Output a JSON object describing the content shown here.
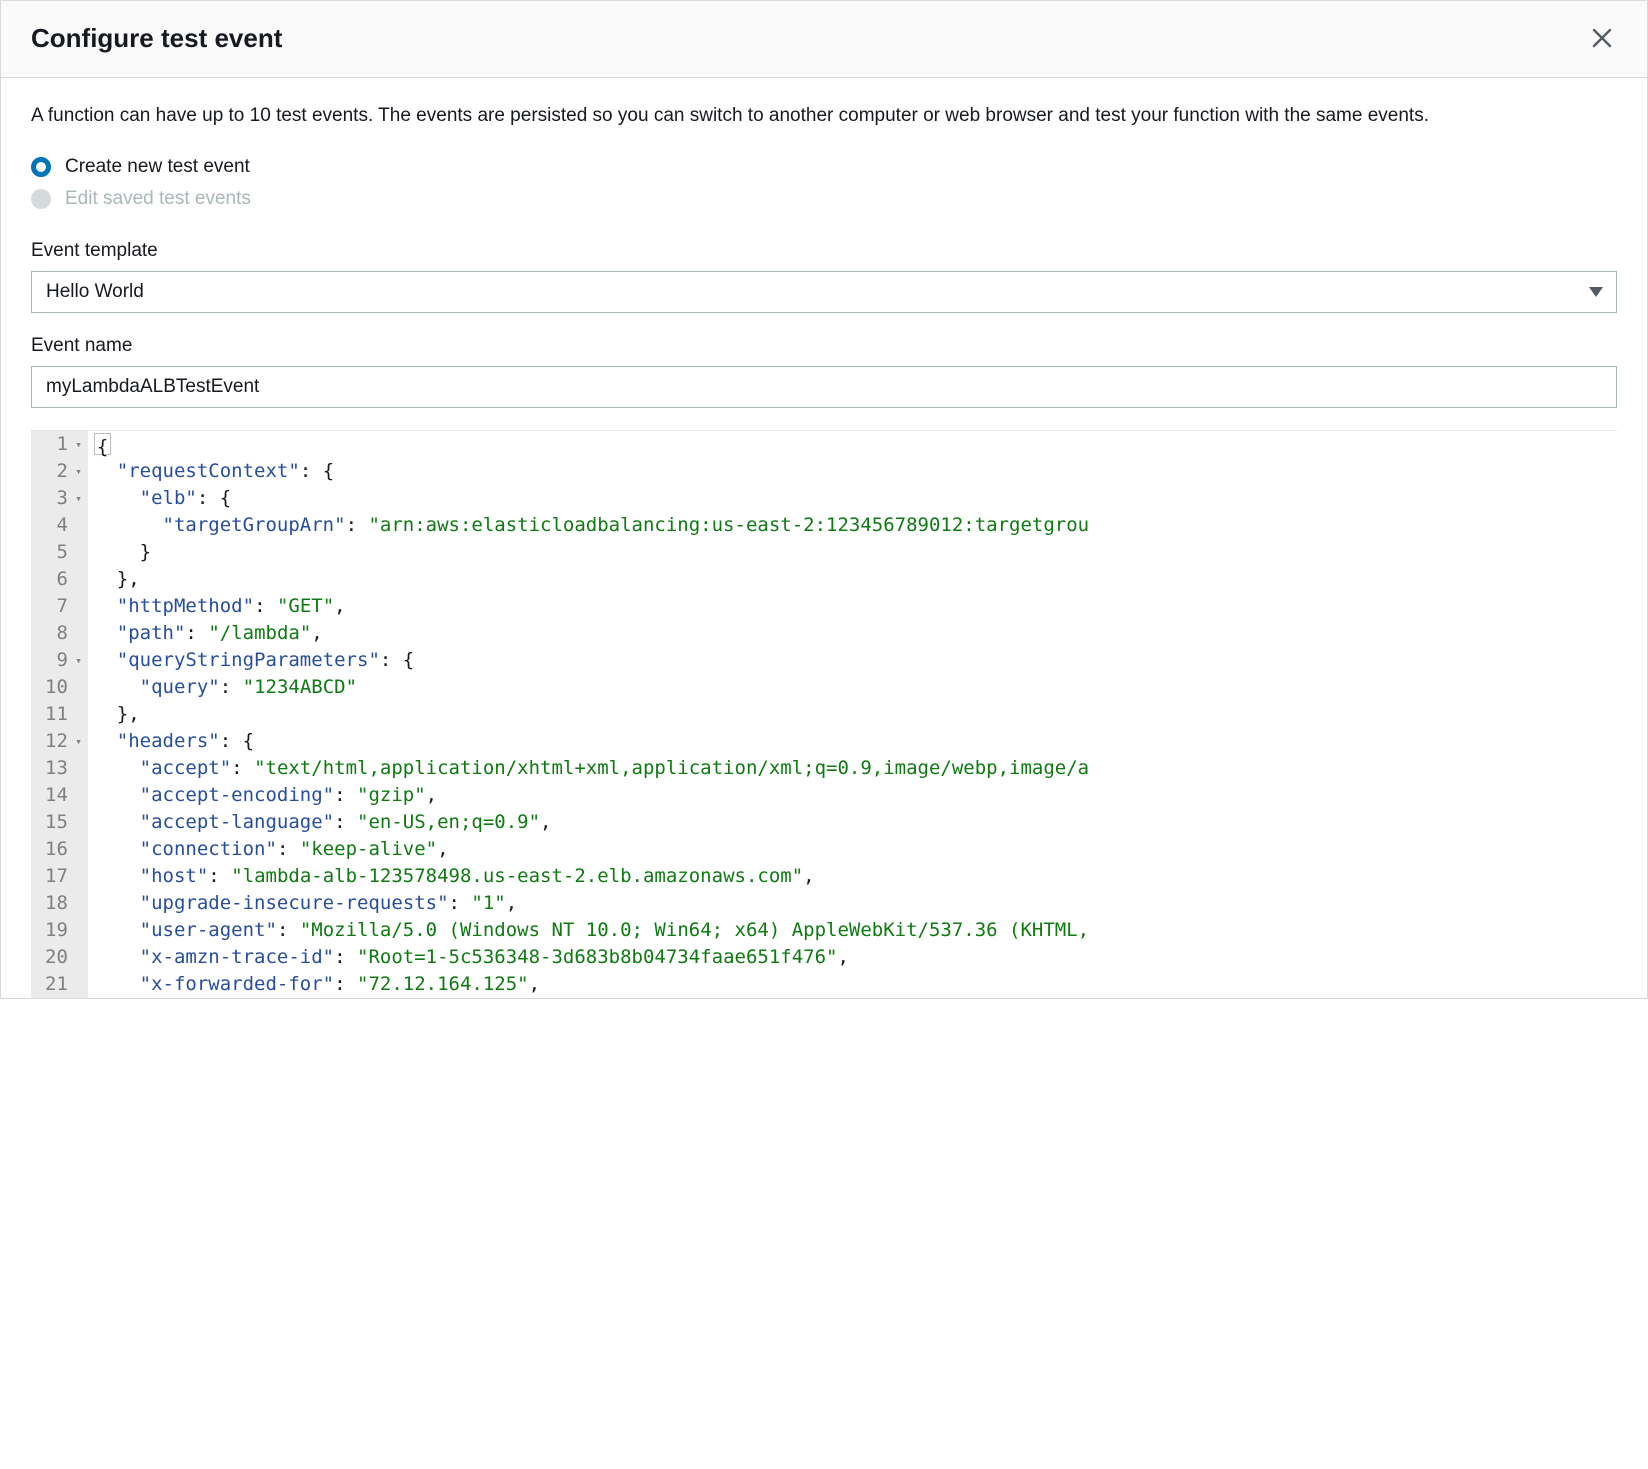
{
  "modal": {
    "title": "Configure test event",
    "description": "A function can have up to 10 test events. The events are persisted so you can switch to another computer or web browser and test your function with the same events."
  },
  "radios": {
    "create": "Create new test event",
    "edit": "Edit saved test events"
  },
  "template": {
    "label": "Event template",
    "value": "Hello World"
  },
  "eventName": {
    "label": "Event name",
    "value": "myLambdaALBTestEvent"
  },
  "code": {
    "lines": [
      {
        "n": 1,
        "fold": true,
        "indent": 0,
        "segs": [
          {
            "t": "{",
            "c": "brace"
          }
        ],
        "active": true
      },
      {
        "n": 2,
        "fold": true,
        "indent": 1,
        "segs": [
          {
            "t": "\"requestContext\"",
            "c": "key"
          },
          {
            "t": ": ",
            "c": "punc"
          },
          {
            "t": "{",
            "c": "brace"
          }
        ]
      },
      {
        "n": 3,
        "fold": true,
        "indent": 2,
        "segs": [
          {
            "t": "\"elb\"",
            "c": "key"
          },
          {
            "t": ": ",
            "c": "punc"
          },
          {
            "t": "{",
            "c": "brace"
          }
        ]
      },
      {
        "n": 4,
        "fold": false,
        "indent": 3,
        "segs": [
          {
            "t": "\"targetGroupArn\"",
            "c": "key"
          },
          {
            "t": ": ",
            "c": "punc"
          },
          {
            "t": "\"arn:aws:elasticloadbalancing:us-east-2:123456789012:targetgrou",
            "c": "str"
          }
        ]
      },
      {
        "n": 5,
        "fold": false,
        "indent": 2,
        "segs": [
          {
            "t": "}",
            "c": "brace"
          }
        ]
      },
      {
        "n": 6,
        "fold": false,
        "indent": 1,
        "segs": [
          {
            "t": "}",
            "c": "brace"
          },
          {
            "t": ",",
            "c": "punc"
          }
        ]
      },
      {
        "n": 7,
        "fold": false,
        "indent": 1,
        "segs": [
          {
            "t": "\"httpMethod\"",
            "c": "key"
          },
          {
            "t": ": ",
            "c": "punc"
          },
          {
            "t": "\"GET\"",
            "c": "str"
          },
          {
            "t": ",",
            "c": "punc"
          }
        ]
      },
      {
        "n": 8,
        "fold": false,
        "indent": 1,
        "segs": [
          {
            "t": "\"path\"",
            "c": "key"
          },
          {
            "t": ": ",
            "c": "punc"
          },
          {
            "t": "\"/lambda\"",
            "c": "str"
          },
          {
            "t": ",",
            "c": "punc"
          }
        ]
      },
      {
        "n": 9,
        "fold": true,
        "indent": 1,
        "segs": [
          {
            "t": "\"queryStringParameters\"",
            "c": "key"
          },
          {
            "t": ": ",
            "c": "punc"
          },
          {
            "t": "{",
            "c": "brace"
          }
        ]
      },
      {
        "n": 10,
        "fold": false,
        "indent": 2,
        "segs": [
          {
            "t": "\"query\"",
            "c": "key"
          },
          {
            "t": ": ",
            "c": "punc"
          },
          {
            "t": "\"1234ABCD\"",
            "c": "str"
          }
        ]
      },
      {
        "n": 11,
        "fold": false,
        "indent": 1,
        "segs": [
          {
            "t": "}",
            "c": "brace"
          },
          {
            "t": ",",
            "c": "punc"
          }
        ]
      },
      {
        "n": 12,
        "fold": true,
        "indent": 1,
        "segs": [
          {
            "t": "\"headers\"",
            "c": "key"
          },
          {
            "t": ": ",
            "c": "punc"
          },
          {
            "t": "{",
            "c": "brace"
          }
        ]
      },
      {
        "n": 13,
        "fold": false,
        "indent": 2,
        "segs": [
          {
            "t": "\"accept\"",
            "c": "key"
          },
          {
            "t": ": ",
            "c": "punc"
          },
          {
            "t": "\"text/html,application/xhtml+xml,application/xml;q=0.9,image/webp,image/a",
            "c": "str"
          }
        ]
      },
      {
        "n": 14,
        "fold": false,
        "indent": 2,
        "segs": [
          {
            "t": "\"accept-encoding\"",
            "c": "key"
          },
          {
            "t": ": ",
            "c": "punc"
          },
          {
            "t": "\"gzip\"",
            "c": "str"
          },
          {
            "t": ",",
            "c": "punc"
          }
        ]
      },
      {
        "n": 15,
        "fold": false,
        "indent": 2,
        "segs": [
          {
            "t": "\"accept-language\"",
            "c": "key"
          },
          {
            "t": ": ",
            "c": "punc"
          },
          {
            "t": "\"en-US,en;q=0.9\"",
            "c": "str"
          },
          {
            "t": ",",
            "c": "punc"
          }
        ]
      },
      {
        "n": 16,
        "fold": false,
        "indent": 2,
        "segs": [
          {
            "t": "\"connection\"",
            "c": "key"
          },
          {
            "t": ": ",
            "c": "punc"
          },
          {
            "t": "\"keep-alive\"",
            "c": "str"
          },
          {
            "t": ",",
            "c": "punc"
          }
        ]
      },
      {
        "n": 17,
        "fold": false,
        "indent": 2,
        "segs": [
          {
            "t": "\"host\"",
            "c": "key"
          },
          {
            "t": ": ",
            "c": "punc"
          },
          {
            "t": "\"lambda-alb-123578498.us-east-2.elb.amazonaws.com\"",
            "c": "str"
          },
          {
            "t": ",",
            "c": "punc"
          }
        ]
      },
      {
        "n": 18,
        "fold": false,
        "indent": 2,
        "segs": [
          {
            "t": "\"upgrade-insecure-requests\"",
            "c": "key"
          },
          {
            "t": ": ",
            "c": "punc"
          },
          {
            "t": "\"1\"",
            "c": "str"
          },
          {
            "t": ",",
            "c": "punc"
          }
        ]
      },
      {
        "n": 19,
        "fold": false,
        "indent": 2,
        "segs": [
          {
            "t": "\"user-agent\"",
            "c": "key"
          },
          {
            "t": ": ",
            "c": "punc"
          },
          {
            "t": "\"Mozilla/5.0 (Windows NT 10.0; Win64; x64) AppleWebKit/537.36 (KHTML,",
            "c": "str"
          }
        ]
      },
      {
        "n": 20,
        "fold": false,
        "indent": 2,
        "segs": [
          {
            "t": "\"x-amzn-trace-id\"",
            "c": "key"
          },
          {
            "t": ": ",
            "c": "punc"
          },
          {
            "t": "\"Root=1-5c536348-3d683b8b04734faae651f476\"",
            "c": "str"
          },
          {
            "t": ",",
            "c": "punc"
          }
        ]
      },
      {
        "n": 21,
        "fold": false,
        "indent": 2,
        "segs": [
          {
            "t": "\"x-forwarded-for\"",
            "c": "key"
          },
          {
            "t": ": ",
            "c": "punc"
          },
          {
            "t": "\"72.12.164.125\"",
            "c": "str"
          },
          {
            "t": ",",
            "c": "punc"
          }
        ]
      }
    ]
  }
}
